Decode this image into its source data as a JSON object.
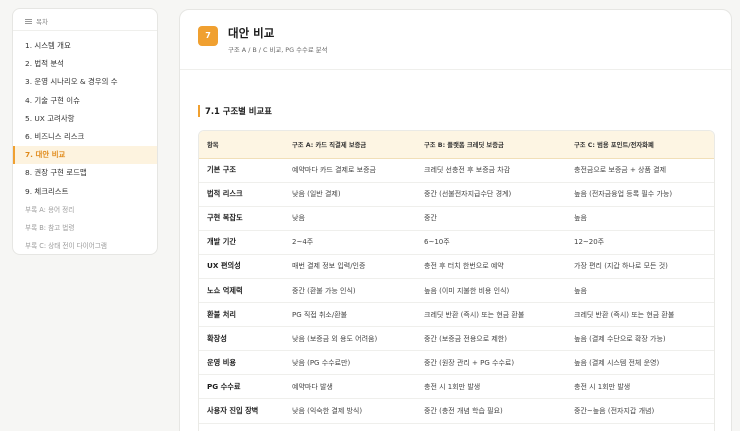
{
  "sidebar": {
    "heading": "목차",
    "items": [
      {
        "label": "1. 시스템 개요"
      },
      {
        "label": "2. 법적 분석"
      },
      {
        "label": "3. 운영 시나리오 & 경우의 수"
      },
      {
        "label": "4. 기술 구현 이슈"
      },
      {
        "label": "5. UX 고려사항"
      },
      {
        "label": "6. 비즈니스 리스크"
      },
      {
        "label": "7. 대안 비교",
        "active": true
      },
      {
        "label": "8. 권장 구현 로드맵"
      },
      {
        "label": "9. 체크리스트"
      },
      {
        "label": "부록 A: 용어 정리",
        "appendix": true
      },
      {
        "label": "부록 B: 참고 법령",
        "appendix": true
      },
      {
        "label": "부록 C: 상태 전이 다이어그램",
        "appendix": true
      }
    ]
  },
  "main": {
    "badge": "7",
    "title": "대안 비교",
    "subtitle": "구조 A / B / C 비교, PG 수수료 분석",
    "section_title": "7.1 구조별 비교표",
    "table": {
      "headers": [
        "항목",
        "구조 A: 카드 직결제 보증금",
        "구조 B: 플랫폼 크레딧 보증금",
        "구조 C: 범용 포인트/전자화폐"
      ],
      "rows": [
        [
          "기본 구조",
          "예약마다 카드 결제로 보증금",
          "크레딧 선충전 후 보증금 차감",
          "충전금으로 보증금 + 상품 결제"
        ],
        [
          "법적 리스크",
          "낮음 (일반 결제)",
          "중간 (선불전자지급수단 경계)",
          "높음 (전자금융업 등록 필수 가능)"
        ],
        [
          "구현 복잡도",
          "낮음",
          "중간",
          "높음"
        ],
        [
          "개발 기간",
          "2~4주",
          "6~10주",
          "12~20주"
        ],
        [
          "UX 편의성",
          "매번 결제 정보 입력/인증",
          "충전 후 터치 한번으로 예약",
          "가장 편리 (지갑 하나로 모든 것)"
        ],
        [
          "노쇼 억제력",
          "중간 (환불 가능 인식)",
          "높음 (이미 지불한 비용 인식)",
          "높음"
        ],
        [
          "환불 처리",
          "PG 직접 취소/환불",
          "크레딧 반환 (즉시) 또는 현금 환불",
          "크레딧 반환 (즉시) 또는 현금 환불"
        ],
        [
          "확장성",
          "낮음 (보증금 외 용도 어려움)",
          "중간 (보증금 전용으로 제한)",
          "높음 (결제 수단으로 확장 가능)"
        ],
        [
          "운영 비용",
          "낮음 (PG 수수료만)",
          "중간 (원장 관리 + PG 수수료)",
          "높음 (결제 시스템 전체 운영)"
        ],
        [
          "PG 수수료",
          "예약마다 발생",
          "충전 시 1회만 발생",
          "충전 시 1회만 발생"
        ],
        [
          "사용자 진입 장벽",
          "낮음 (익숙한 결제 방식)",
          "중간 (충전 개념 학습 필요)",
          "중간~높음 (전자지갑 개념)"
        ]
      ]
    }
  },
  "colors": {
    "accent": "#f0a030",
    "active_bg": "#fdf3df",
    "table_header_bg": "#fdf5e3"
  }
}
